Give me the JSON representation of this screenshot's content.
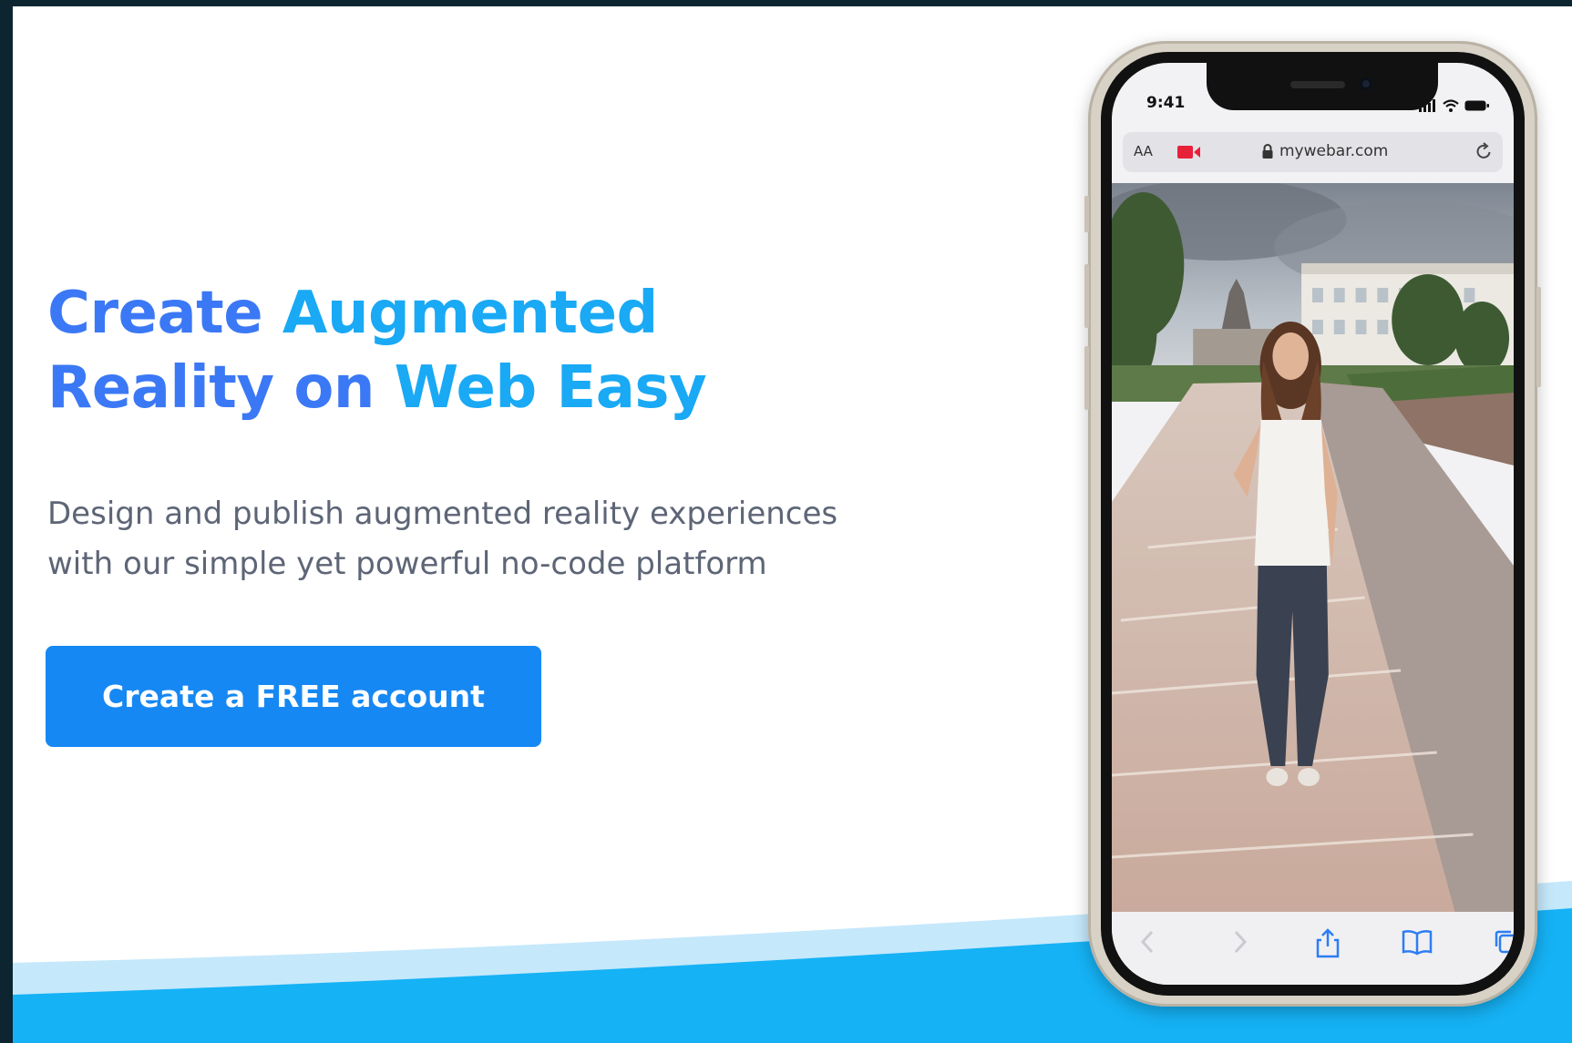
{
  "hero": {
    "title_part1": "Create ",
    "title_part2": "Augmented",
    "title_part3": "Reality on ",
    "title_part4": "Web Easy",
    "subtitle_line1": "Design and publish augmented reality experiences",
    "subtitle_line2": "with our simple yet powerful no-code platform",
    "cta_label": "Create a FREE account"
  },
  "phone": {
    "time": "9:41",
    "text_size_label": "AA",
    "url": "mywebar.com",
    "icons": [
      "recording-camera-icon",
      "lock-icon",
      "reload-icon",
      "back-icon",
      "forward-icon",
      "share-icon",
      "bookmarks-icon",
      "tabs-icon",
      "signal-icon",
      "wifi-icon",
      "battery-icon"
    ]
  },
  "colors": {
    "title_blue": "#3b78f5",
    "title_cyan": "#19a9f5",
    "cta_bg": "#1688f3",
    "wave_light": "#c5e8fb",
    "wave_dark": "#15b2f5",
    "frame_bg": "#0c2530"
  }
}
